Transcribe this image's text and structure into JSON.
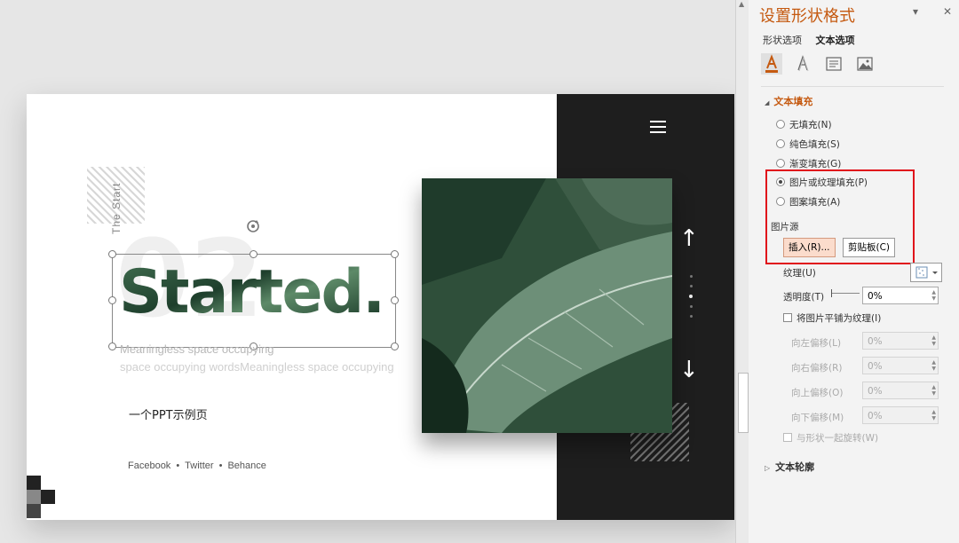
{
  "slide": {
    "vertical_text": "The Start",
    "big_number": "02",
    "headline": "Started.",
    "subtitle_line1": "Meaningless space occupying",
    "subtitle_line2": "space occupying wordsMeaningless space occupying",
    "cn_title": "一个PPT示例页",
    "social": [
      "Facebook",
      "Twitter",
      "Behance"
    ],
    "separator": "•",
    "arrow_up": "↑",
    "arrow_down": "↓"
  },
  "panel": {
    "title": "设置形状格式",
    "collapse_glyph": "▾",
    "close_glyph": "✕",
    "tabs": [
      "形状选项",
      "文本选项"
    ],
    "icons": [
      "text-fill-outline-icon",
      "text-effects-icon",
      "textbox-icon",
      "picture-icon"
    ],
    "text_fill_section": "文本填充",
    "fill_options": [
      "无填充(N)",
      "纯色填充(S)",
      "渐变填充(G)",
      "图片或纹理填充(P)",
      "图案填充(A)"
    ],
    "picture_source_label": "图片源",
    "insert_button": "插入(R)...",
    "clipboard_button": "剪贴板(C)",
    "texture_label": "纹理(U)",
    "transparency_label": "透明度(T)",
    "transparency_value": "0%",
    "tile_label": "将图片平铺为纹理(I)",
    "offsets": [
      {
        "label": "向左偏移(L)",
        "value": "0%"
      },
      {
        "label": "向右偏移(R)",
        "value": "0%"
      },
      {
        "label": "向上偏移(O)",
        "value": "0%"
      },
      {
        "label": "向下偏移(M)",
        "value": "0%"
      }
    ],
    "rotate_with_shape": "与形状一起旋转(W)",
    "text_outline_section": "文本轮廓",
    "accent_color": "#c55a11",
    "highlight_color": "#e0121b"
  }
}
